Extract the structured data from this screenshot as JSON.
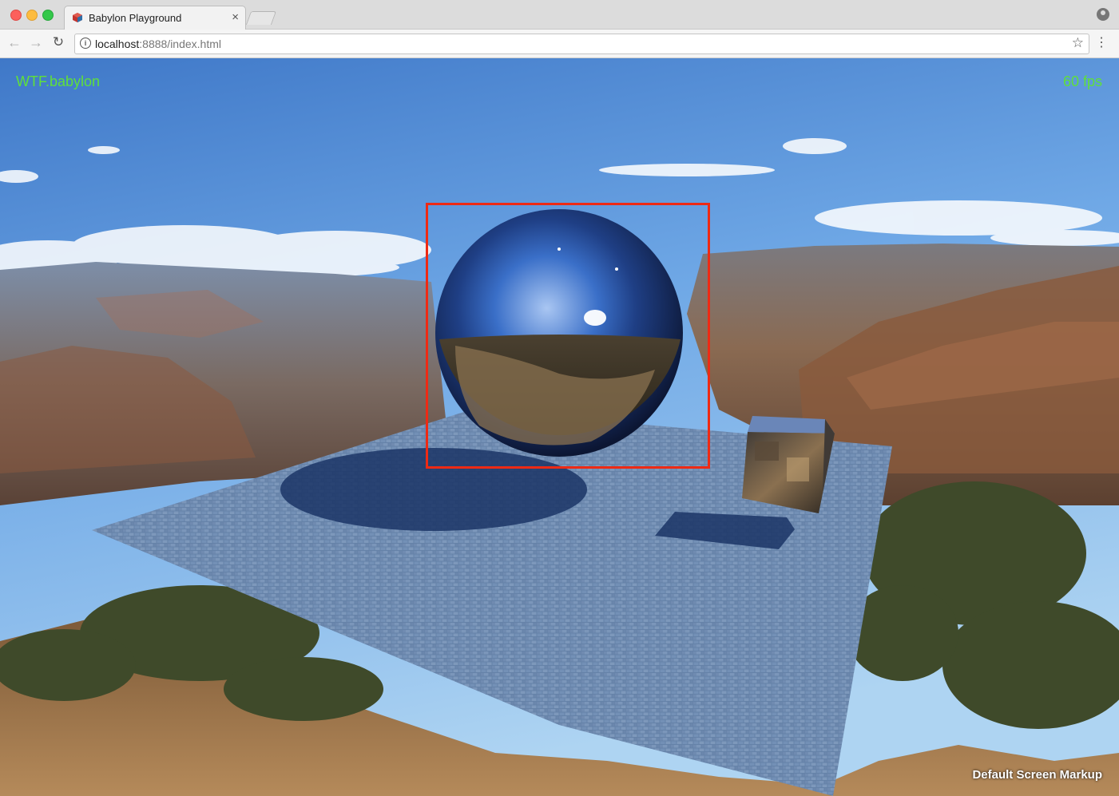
{
  "browser": {
    "tab_title": "Babylon Playground",
    "tab_close": "×",
    "url_host": "localhost",
    "url_path": ":8888/index.html",
    "star": "☆",
    "menu": "⋮",
    "back": "←",
    "forward": "→",
    "reload": "↻",
    "info": "i"
  },
  "scene": {
    "file_label": "WTF.babylon",
    "fps_label": "60 fps",
    "markup_label": "Default Screen Markup",
    "accent_color": "#5fe03a",
    "highlight_color": "#ee2a14",
    "objects": [
      "sky",
      "canyon",
      "floor-plane",
      "chrome-sphere",
      "chrome-cube",
      "sphere-shadow",
      "cube-shadow"
    ]
  }
}
